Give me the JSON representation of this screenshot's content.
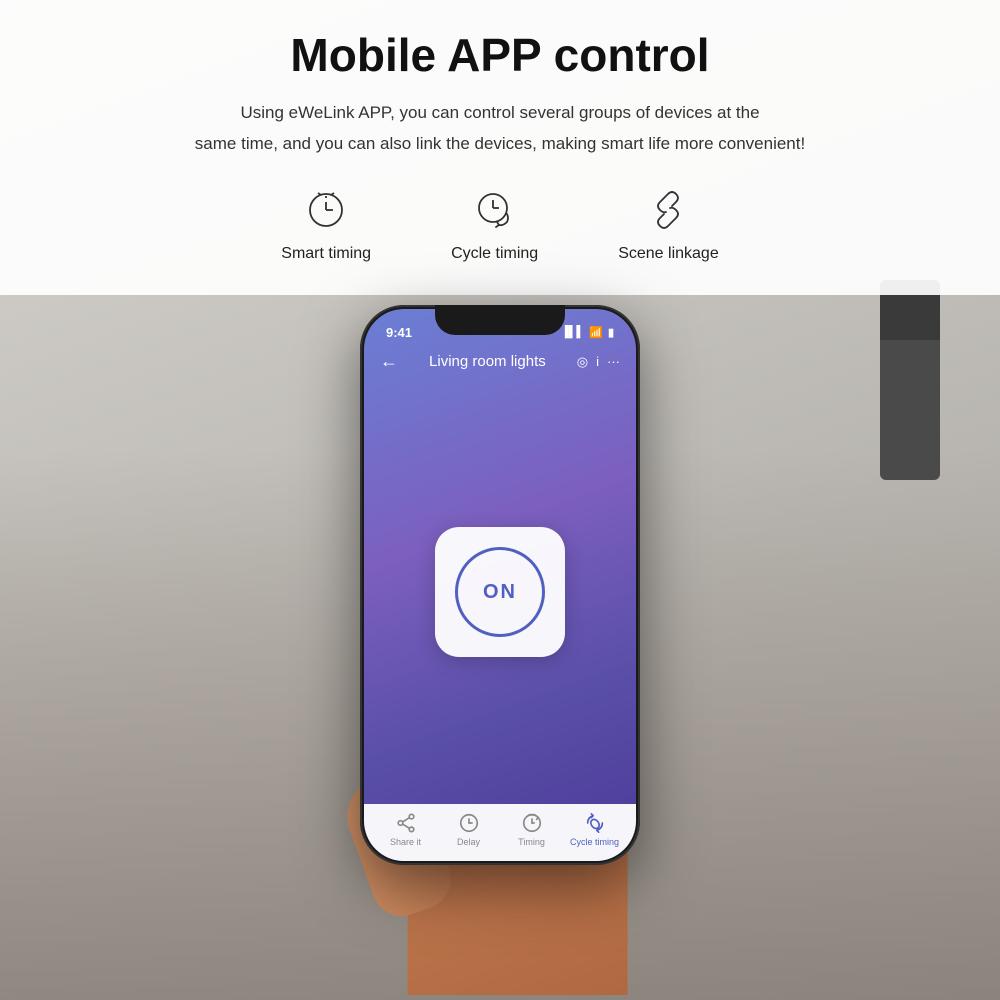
{
  "page": {
    "title": "Mobile APP control",
    "subtitle_line1": "Using eWeLink APP, you can control several groups of devices at the",
    "subtitle_line2": "same time, and you can also link the devices, making smart life more convenient!"
  },
  "features": [
    {
      "id": "smart-timing",
      "label": "Smart timing",
      "icon": "clock-icon"
    },
    {
      "id": "cycle-timing",
      "label": "Cycle timing",
      "icon": "cycle-clock-icon"
    },
    {
      "id": "scene-linkage",
      "label": "Scene linkage",
      "icon": "link-icon"
    }
  ],
  "phone": {
    "status": {
      "time": "9:41",
      "signal": "●●●",
      "wifi": "wifi",
      "battery": "battery"
    },
    "header": {
      "back": "←",
      "title": "Living room lights",
      "icon1": "◎",
      "icon2": "i",
      "icon3": "···"
    },
    "main_button": {
      "label": "ON"
    },
    "bottom_nav": [
      {
        "label": "Share it",
        "active": false
      },
      {
        "label": "Delay",
        "active": false
      },
      {
        "label": "Timing",
        "active": false
      },
      {
        "label": "Cycle timing",
        "active": true
      }
    ]
  }
}
